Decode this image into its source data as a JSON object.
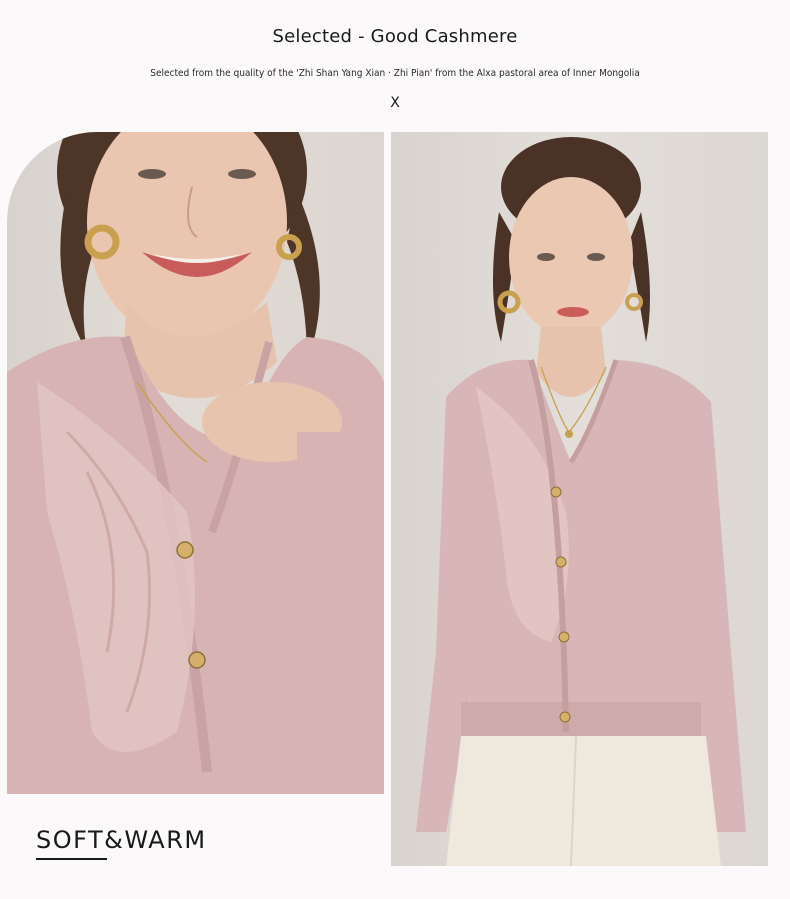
{
  "header": {
    "title": "Selected - Good Cashmere",
    "subtitle": "Selected from the quality of the 'Zhi Shan Yang Xian · Zhi Pian' from the Alxa pastoral area of Inner Mongolia",
    "separator": "X"
  },
  "tagline": "SOFT&WARM",
  "colors": {
    "sweater": "#d9b6b7",
    "background_wall": "#ddd7d2",
    "skirt": "#efe8dd",
    "hair": "#4a3326"
  }
}
